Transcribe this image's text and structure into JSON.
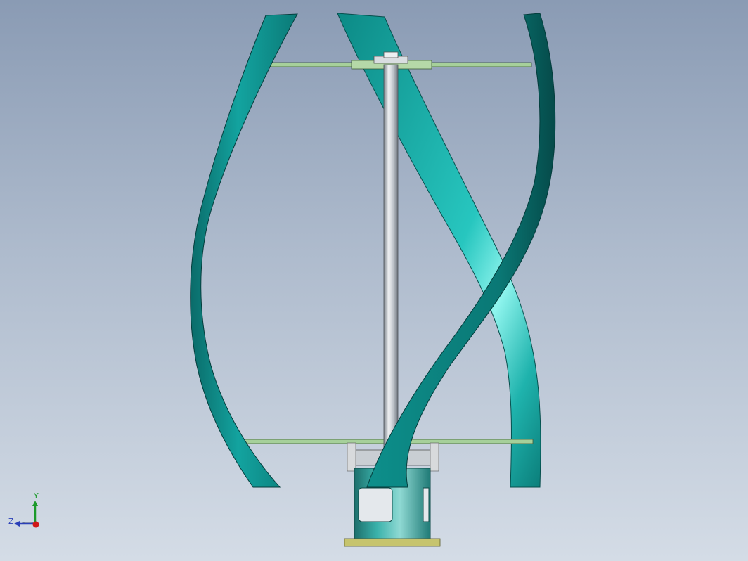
{
  "viewport": {
    "background_top": "#8a9bb4",
    "background_bottom": "#d4dce6"
  },
  "model": {
    "name": "vertical-axis-helical-wind-turbine",
    "blade_color": "#0f8f8c",
    "blade_dark": "#054c4b",
    "blade_highlight": "#7ff1ea",
    "arm_color": "#a6d09a",
    "shaft_color": "#c7ccd3",
    "base_color": "#2f9e98",
    "flange_color": "#c6c46e"
  },
  "triad": {
    "y_label": "Y",
    "z_label": "Z",
    "x_color": "#d01818",
    "y_color": "#1b9a2a",
    "z_color": "#2a3fb8"
  }
}
